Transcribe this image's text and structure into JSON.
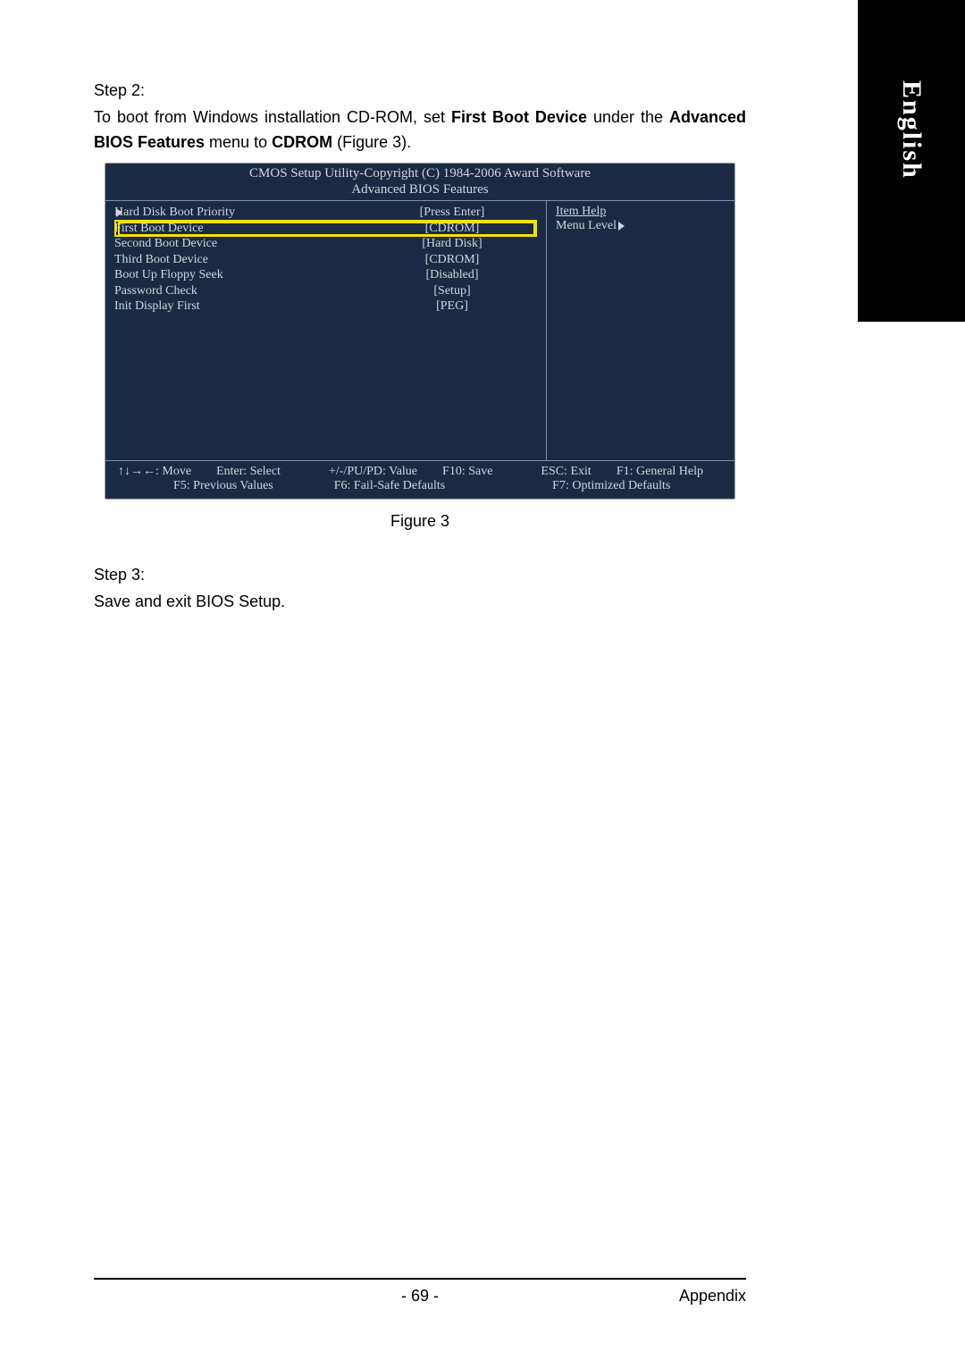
{
  "language_tab": "English",
  "step2": {
    "title": "Step 2:",
    "text_before_bold1": "To boot from Windows installation CD-ROM, set ",
    "bold1": "First Boot Device",
    "text_mid1": " under the ",
    "bold2": "Advanced BIOS Features",
    "text_mid2": " menu to ",
    "bold3": "CDROM",
    "text_after": " (Figure 3)."
  },
  "bios": {
    "header_line1": "CMOS Setup Utility-Copyright (C) 1984-2006 Award Software",
    "header_line2": "Advanced BIOS Features",
    "rows": [
      {
        "label": "Hard Disk Boot Priority",
        "value": "[Press Enter]",
        "caret": true,
        "highlight": false
      },
      {
        "label": "First Boot Device",
        "value": "[CDROM]",
        "caret": false,
        "highlight": true
      },
      {
        "label": "Second Boot Device",
        "value": "[Hard Disk]",
        "caret": false,
        "highlight": false
      },
      {
        "label": "Third Boot Device",
        "value": "[CDROM]",
        "caret": false,
        "highlight": false
      },
      {
        "label": "Boot Up Floppy Seek",
        "value": "[Disabled]",
        "caret": false,
        "highlight": false
      },
      {
        "label": "Password Check",
        "value": "[Setup]",
        "caret": false,
        "highlight": false
      },
      {
        "label": "Init Display First",
        "value": "[PEG]",
        "caret": false,
        "highlight": false
      }
    ],
    "help": {
      "item_help": "Item Help",
      "menu_level": "Menu Level"
    },
    "footer": {
      "r1c1": "↑↓→←: Move",
      "r1c2": "Enter: Select",
      "r1c3": "+/-/PU/PD: Value",
      "r1c4": "F10: Save",
      "r1c5": "ESC: Exit",
      "r1c6": "F1: General Help",
      "r2c1": "F5: Previous Values",
      "r2c2": "F6: Fail-Safe Defaults",
      "r2c3": "F7: Optimized Defaults"
    }
  },
  "figure_caption": "Figure 3",
  "step3": {
    "title": "Step 3:",
    "text": "Save and exit BIOS Setup."
  },
  "footer": {
    "page_number": "- 69 -",
    "section": "Appendix"
  }
}
